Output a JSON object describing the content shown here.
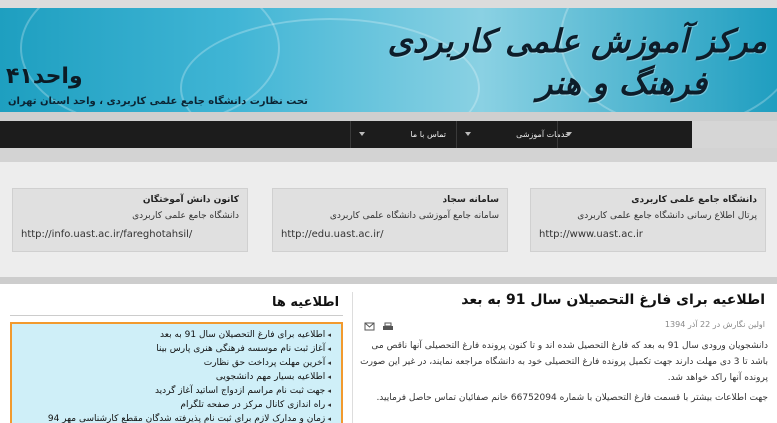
{
  "banner": {
    "title_line1": "مرکز آموزش علمی کاربردی",
    "title_line2": "فرهنگ و هنر",
    "vahed": "واحد۴۱",
    "subtitle": "تحت نظارت دانشگاه جامع علمی کاربردی ، واحد استان تهران"
  },
  "nav": {
    "items": [
      {
        "label": "خدمات آموزشی"
      },
      {
        "label": "تماس با ما"
      }
    ]
  },
  "cards": [
    {
      "title": "دانشگاه جامع علمی کاربردی",
      "desc": "پرتال اطلاع رسانی دانشگاه جامع علمی کاربردی",
      "url": "http://www.uast.ac.ir"
    },
    {
      "title": "سامانه سجاد",
      "desc": "سامانه جامع آموزشی دانشگاه علمی کاربردی",
      "url": "http://edu.uast.ac.ir/"
    },
    {
      "title": "کانون دانش آموختگان",
      "desc": "دانشگاه جامع علمی کاربردی",
      "url": "http://info.uast.ac.ir/fareghotahsil/"
    }
  ],
  "article": {
    "title": "اطلاعیه برای فارغ التحصیلان سال 91 به بعد",
    "meta": "اولین نگارش در 22 آذر 1394",
    "body1": "دانشجویان ورودی سال 91 به بعد که فارغ التحصیل شده اند و تا کنون پرونده فارغ التحصیلی آنها ناقص می باشد تا 3 دی مهلت دارند جهت تکمیل پرونده فارغ التحصیلی خود به دانشگاه مراجعه نمایند، در غیر این صورت پرونده آنها راکد خواهد شد.",
    "body2": "جهت اطلاعات بیشتر با قسمت فارغ التحصیلان با شماره 66752094 خانم صفائیان تماس حاصل فرمایید."
  },
  "sidebar": {
    "title": "اطلاعیه ها",
    "items": [
      "اطلاعیه برای فارغ التحصیلان سال 91 به بعد",
      "آغاز ثبت نام موسسه فرهنگی هنری پارس بینا",
      "آخرین مهلت پرداخت حق نظارت",
      "اطلاعیه بسیار مهم دانشجویی",
      "جهت ثبت نام مراسم ازدواج اساتید آغاز گردید",
      "راه اندازی کانال مرکز در صفحه تلگرام",
      "زمان و مدارک لازم برای ثبت نام پذیرفته شدگان مقطع کارشناسی مهر 94"
    ]
  },
  "colors": {
    "banner": "#2aa6c6",
    "nav": "#1c1c1c",
    "notice_bg": "#cfeff8",
    "notice_border": "#f29a2e"
  }
}
